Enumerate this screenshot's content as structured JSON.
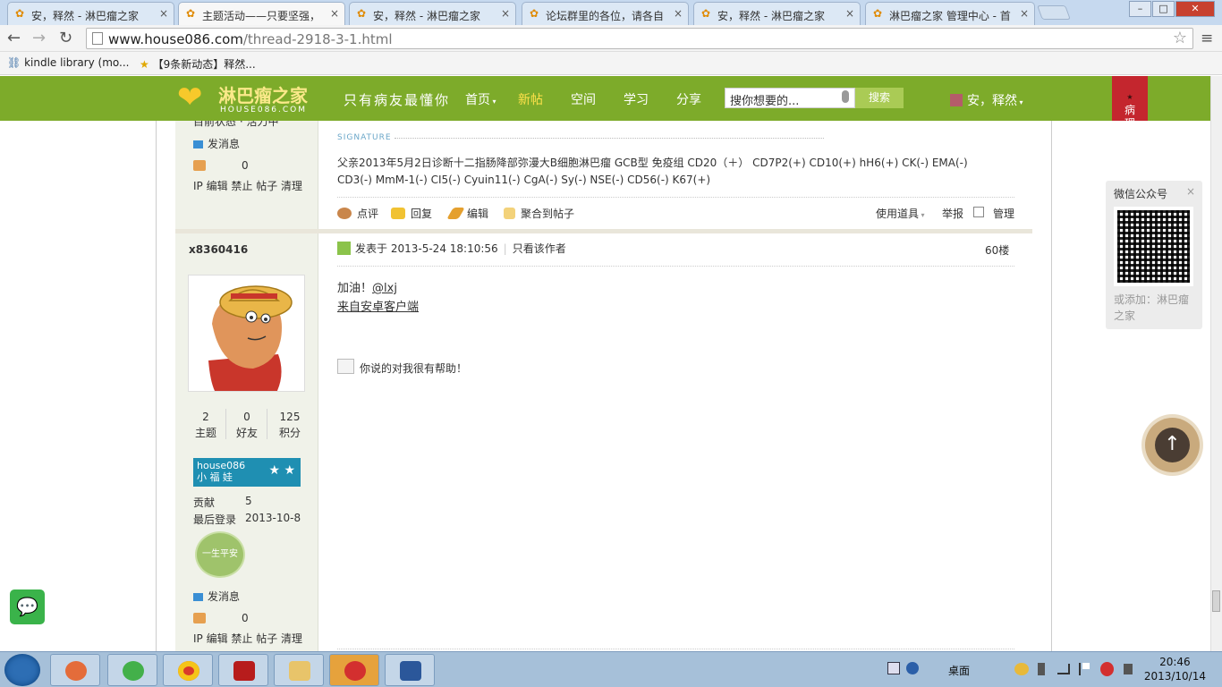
{
  "browser": {
    "tabs": [
      {
        "label": "安，释然 - 淋巴瘤之家",
        "active": false
      },
      {
        "label": "主题活动——只要坚强，",
        "active": true
      },
      {
        "label": "安，释然 - 淋巴瘤之家",
        "active": false
      },
      {
        "label": "论坛群里的各位，请各自",
        "active": false
      },
      {
        "label": "安，释然 - 淋巴瘤之家",
        "active": false
      },
      {
        "label": "淋巴瘤之家 管理中心 - 首",
        "active": false
      }
    ],
    "tab_close": "×",
    "url_host": "www.house086.com",
    "url_path": "/thread-2918-3-1.html",
    "bookmarks": [
      "kindle library (mo...",
      "【9条新动态】释然..."
    ],
    "window_buttons": [
      "–",
      "□",
      "✕"
    ]
  },
  "site": {
    "logo_name": "淋巴瘤之家",
    "logo_domain": "HOUSE086.COM",
    "slogan": "只有病友最懂你",
    "nav": [
      "首页",
      "新帖",
      "空间",
      "学习",
      "分享"
    ],
    "nav_active": "新帖",
    "search_placeholder": "搜你想要的...",
    "search_button": "搜索",
    "user": "安，释然",
    "ribbon": "病理会诊"
  },
  "prev_post": {
    "online_status": "目前状态 · 活力中",
    "send_msg": "发消息",
    "likes": "0",
    "admin_links": "IP 编辑 禁止 帖子 清理",
    "signature_label": "SIGNATURE",
    "signature": "父亲2013年5月2日诊断十二指肠降部弥漫大B细胞淋巴瘤 GCB型 免疫组 CD20（＋） CD7P2(+) CD10(+)  hH6(+) CK(-) EMA(-) CD3(-) MmM-1(-) CI5(-) Cyuin11(-) CgA(-) Sy(-) NSE(-) CD56(-) K67(+)",
    "actions": [
      "点评",
      "回复",
      "编辑",
      "聚合到帖子"
    ],
    "tools": "使用道具",
    "report": "举报",
    "manage": "管理"
  },
  "post": {
    "author": "x8360416",
    "stats": [
      {
        "value": "2",
        "label": "主题"
      },
      {
        "value": "0",
        "label": "好友"
      },
      {
        "value": "125",
        "label": "积分"
      }
    ],
    "badge_name": "house086",
    "badge_rank": "小 福 娃",
    "badge_stars": "★ ★",
    "contrib_label": "贡献",
    "contrib_value": "5",
    "lastlogin_label": "最后登录",
    "lastlogin_value": "2013-10-8",
    "medal": "一生平安",
    "send_msg": "发消息",
    "likes": "0",
    "admin_links": "IP 编辑 禁止 帖子 清理",
    "posted_prefix": "发表于",
    "posted_time": "2013-5-24 18:10:56",
    "only_author": "只看该作者",
    "floor": "60楼",
    "message_text": "加油！",
    "mention": "@lxj",
    "client_link": "来自安卓客户端",
    "rating": "你说的对我很有帮助！"
  },
  "side": {
    "wechat_title": "微信公众号",
    "wechat_close": "×",
    "wechat_sub": "或添加：淋巴瘤之家",
    "to_top": "↑"
  },
  "taskbar": {
    "desktop": "桌面",
    "time": "20:46",
    "date": "2013/10/14"
  }
}
